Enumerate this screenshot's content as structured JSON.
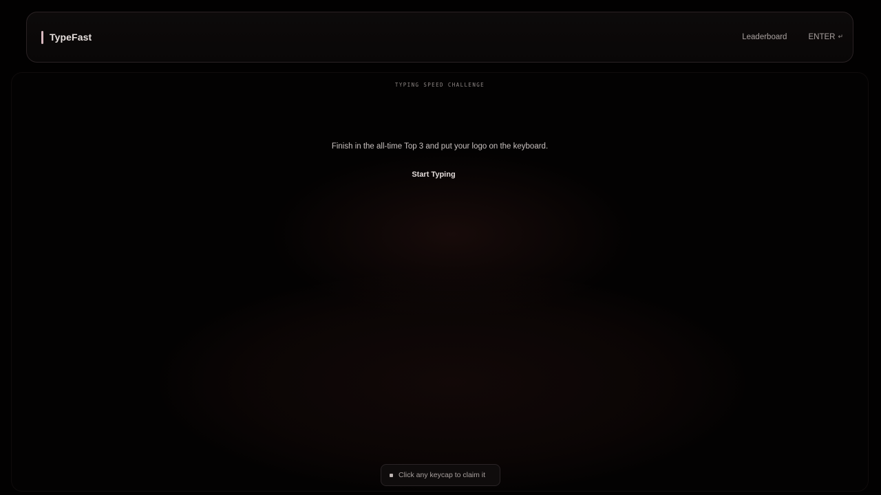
{
  "header": {
    "brand": "TypeFast",
    "nav": {
      "leaderboard": "Leaderboard",
      "enter": "ENTER",
      "enter_glyph": "↵"
    }
  },
  "stage": {
    "eyebrow": "TYPING SPEED CHALLENGE",
    "tagline": "Finish in the all-time Top 3 and put your logo on the keyboard.",
    "start_button": "Start Typing"
  },
  "hint": {
    "text": "Click any keycap to claim it",
    "icon": "square-dot-icon"
  },
  "colors": {
    "background": "#020101",
    "brand_accent": "#d9b9bf",
    "glow": "#281210"
  }
}
